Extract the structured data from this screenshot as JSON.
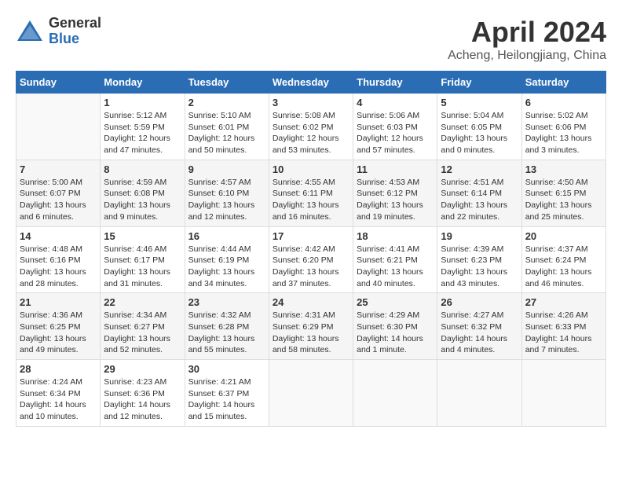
{
  "header": {
    "logo_general": "General",
    "logo_blue": "Blue",
    "title": "April 2024",
    "subtitle": "Acheng, Heilongjiang, China"
  },
  "weekdays": [
    "Sunday",
    "Monday",
    "Tuesday",
    "Wednesday",
    "Thursday",
    "Friday",
    "Saturday"
  ],
  "weeks": [
    [
      {
        "day": "",
        "info": ""
      },
      {
        "day": "1",
        "info": "Sunrise: 5:12 AM\nSunset: 5:59 PM\nDaylight: 12 hours\nand 47 minutes."
      },
      {
        "day": "2",
        "info": "Sunrise: 5:10 AM\nSunset: 6:01 PM\nDaylight: 12 hours\nand 50 minutes."
      },
      {
        "day": "3",
        "info": "Sunrise: 5:08 AM\nSunset: 6:02 PM\nDaylight: 12 hours\nand 53 minutes."
      },
      {
        "day": "4",
        "info": "Sunrise: 5:06 AM\nSunset: 6:03 PM\nDaylight: 12 hours\nand 57 minutes."
      },
      {
        "day": "5",
        "info": "Sunrise: 5:04 AM\nSunset: 6:05 PM\nDaylight: 13 hours\nand 0 minutes."
      },
      {
        "day": "6",
        "info": "Sunrise: 5:02 AM\nSunset: 6:06 PM\nDaylight: 13 hours\nand 3 minutes."
      }
    ],
    [
      {
        "day": "7",
        "info": "Sunrise: 5:00 AM\nSunset: 6:07 PM\nDaylight: 13 hours\nand 6 minutes."
      },
      {
        "day": "8",
        "info": "Sunrise: 4:59 AM\nSunset: 6:08 PM\nDaylight: 13 hours\nand 9 minutes."
      },
      {
        "day": "9",
        "info": "Sunrise: 4:57 AM\nSunset: 6:10 PM\nDaylight: 13 hours\nand 12 minutes."
      },
      {
        "day": "10",
        "info": "Sunrise: 4:55 AM\nSunset: 6:11 PM\nDaylight: 13 hours\nand 16 minutes."
      },
      {
        "day": "11",
        "info": "Sunrise: 4:53 AM\nSunset: 6:12 PM\nDaylight: 13 hours\nand 19 minutes."
      },
      {
        "day": "12",
        "info": "Sunrise: 4:51 AM\nSunset: 6:14 PM\nDaylight: 13 hours\nand 22 minutes."
      },
      {
        "day": "13",
        "info": "Sunrise: 4:50 AM\nSunset: 6:15 PM\nDaylight: 13 hours\nand 25 minutes."
      }
    ],
    [
      {
        "day": "14",
        "info": "Sunrise: 4:48 AM\nSunset: 6:16 PM\nDaylight: 13 hours\nand 28 minutes."
      },
      {
        "day": "15",
        "info": "Sunrise: 4:46 AM\nSunset: 6:17 PM\nDaylight: 13 hours\nand 31 minutes."
      },
      {
        "day": "16",
        "info": "Sunrise: 4:44 AM\nSunset: 6:19 PM\nDaylight: 13 hours\nand 34 minutes."
      },
      {
        "day": "17",
        "info": "Sunrise: 4:42 AM\nSunset: 6:20 PM\nDaylight: 13 hours\nand 37 minutes."
      },
      {
        "day": "18",
        "info": "Sunrise: 4:41 AM\nSunset: 6:21 PM\nDaylight: 13 hours\nand 40 minutes."
      },
      {
        "day": "19",
        "info": "Sunrise: 4:39 AM\nSunset: 6:23 PM\nDaylight: 13 hours\nand 43 minutes."
      },
      {
        "day": "20",
        "info": "Sunrise: 4:37 AM\nSunset: 6:24 PM\nDaylight: 13 hours\nand 46 minutes."
      }
    ],
    [
      {
        "day": "21",
        "info": "Sunrise: 4:36 AM\nSunset: 6:25 PM\nDaylight: 13 hours\nand 49 minutes."
      },
      {
        "day": "22",
        "info": "Sunrise: 4:34 AM\nSunset: 6:27 PM\nDaylight: 13 hours\nand 52 minutes."
      },
      {
        "day": "23",
        "info": "Sunrise: 4:32 AM\nSunset: 6:28 PM\nDaylight: 13 hours\nand 55 minutes."
      },
      {
        "day": "24",
        "info": "Sunrise: 4:31 AM\nSunset: 6:29 PM\nDaylight: 13 hours\nand 58 minutes."
      },
      {
        "day": "25",
        "info": "Sunrise: 4:29 AM\nSunset: 6:30 PM\nDaylight: 14 hours\nand 1 minute."
      },
      {
        "day": "26",
        "info": "Sunrise: 4:27 AM\nSunset: 6:32 PM\nDaylight: 14 hours\nand 4 minutes."
      },
      {
        "day": "27",
        "info": "Sunrise: 4:26 AM\nSunset: 6:33 PM\nDaylight: 14 hours\nand 7 minutes."
      }
    ],
    [
      {
        "day": "28",
        "info": "Sunrise: 4:24 AM\nSunset: 6:34 PM\nDaylight: 14 hours\nand 10 minutes."
      },
      {
        "day": "29",
        "info": "Sunrise: 4:23 AM\nSunset: 6:36 PM\nDaylight: 14 hours\nand 12 minutes."
      },
      {
        "day": "30",
        "info": "Sunrise: 4:21 AM\nSunset: 6:37 PM\nDaylight: 14 hours\nand 15 minutes."
      },
      {
        "day": "",
        "info": ""
      },
      {
        "day": "",
        "info": ""
      },
      {
        "day": "",
        "info": ""
      },
      {
        "day": "",
        "info": ""
      }
    ]
  ]
}
